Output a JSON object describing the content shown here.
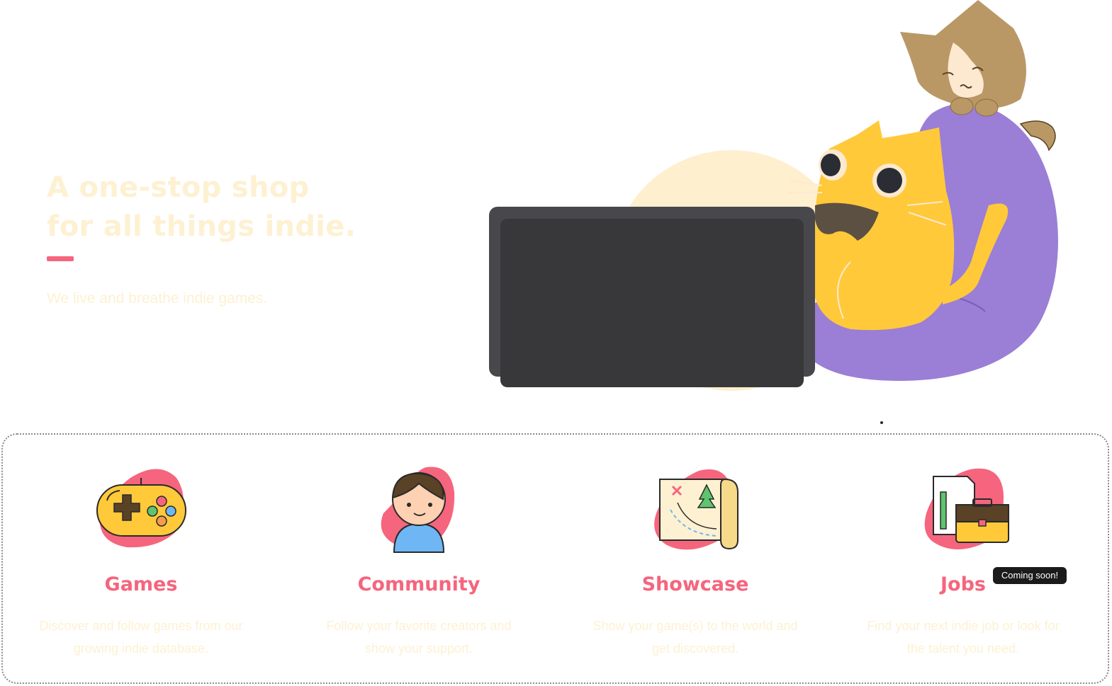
{
  "hero": {
    "title_line1": "A one-stop shop",
    "title_line2": "for all things indie.",
    "subtitle": "We live and breathe indie games."
  },
  "features": [
    {
      "title": "Games",
      "description": "Discover and follow games from our growing indie database.",
      "icon": "gamepad-icon"
    },
    {
      "title": "Community",
      "description": "Follow your favorite creators and show your support.",
      "icon": "person-icon"
    },
    {
      "title": "Showcase",
      "description": "Show your game(s) to the world and get discovered.",
      "icon": "map-icon"
    },
    {
      "title": "Jobs",
      "description": "Find your next indie job or look for the talent you need.",
      "icon": "briefcase-icon",
      "badge": "Coming soon!"
    }
  ],
  "colors": {
    "accent": "#f5657d",
    "hero_text": "#fdf1d2",
    "beanbag": "#9b7ed6",
    "yellow_cat": "#ffc93a",
    "brown_cat": "#b99866",
    "laptop": "#38383b"
  }
}
